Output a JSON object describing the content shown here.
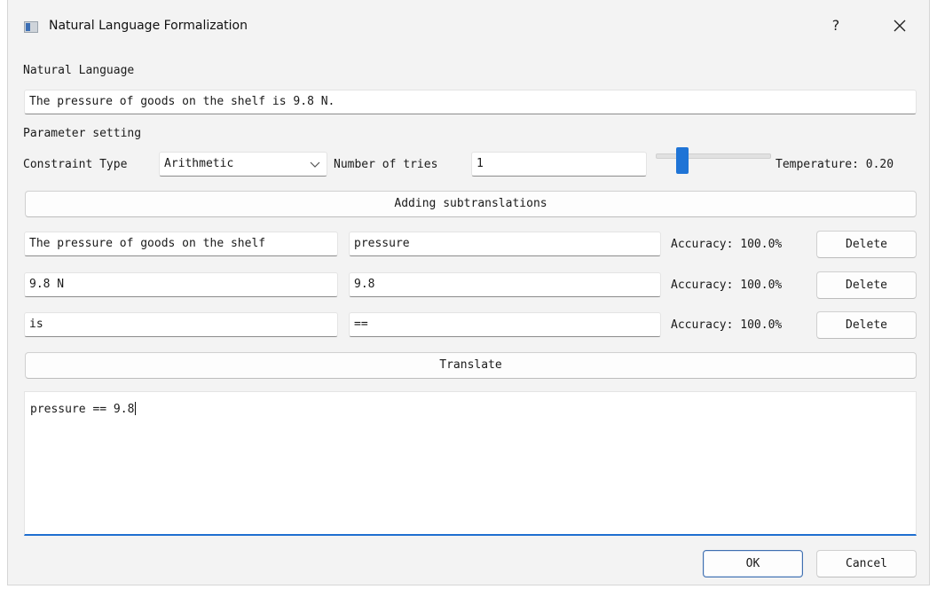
{
  "window": {
    "title": "Natural Language Formalization",
    "help_label": "?"
  },
  "natural_language": {
    "label": "Natural Language",
    "value": "The pressure of goods on the shelf is 9.8 N."
  },
  "parameters": {
    "section_label": "Parameter setting",
    "constraint_type_label": "Constraint Type",
    "constraint_type_value": "Arithmetic",
    "tries_label": "Number of tries",
    "tries_value": "1",
    "temperature_label": "Temperature: 0.20",
    "temperature_value": 0.2
  },
  "add_button_label": "Adding subtranslations",
  "subtranslations": [
    {
      "source": "The pressure of goods on the shelf",
      "target": "pressure",
      "accuracy": "Accuracy: 100.0%",
      "delete_label": "Delete"
    },
    {
      "source": "9.8 N",
      "target": "9.8",
      "accuracy": "Accuracy: 100.0%",
      "delete_label": "Delete"
    },
    {
      "source": "is",
      "target": "==",
      "accuracy": "Accuracy: 100.0%",
      "delete_label": "Delete"
    }
  ],
  "translate_button_label": "Translate",
  "output": {
    "text": "pressure == 9.8"
  },
  "footer": {
    "ok_label": "OK",
    "cancel_label": "Cancel"
  }
}
